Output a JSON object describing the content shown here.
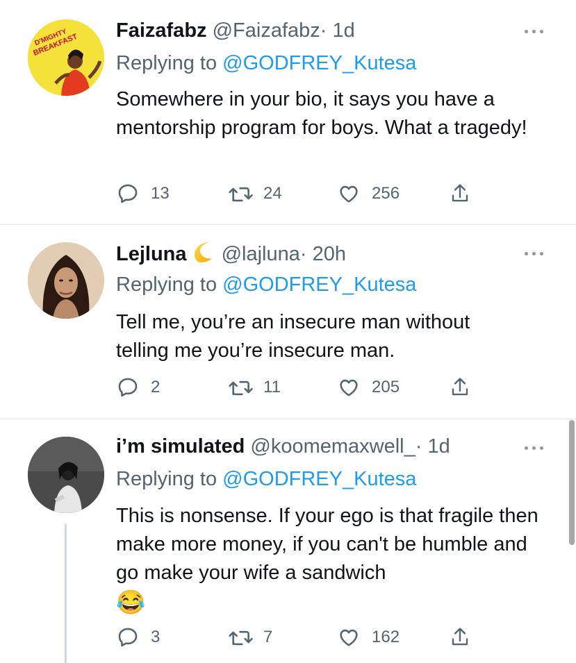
{
  "colors": {
    "link": "#1d9bf0",
    "muted": "#536471",
    "text": "#0f1419"
  },
  "tweets": [
    {
      "display_name": "Faizafabz",
      "handle": "@Faizafabz",
      "time": "· 1d",
      "replying_prefix": "Replying to",
      "replying_to": "@GODFREY_Kutesa",
      "text": "Somewhere in your bio, it says you have a mentorship program for boys. What a tragedy!",
      "replies": "13",
      "retweets": "24",
      "likes": "256",
      "avatar_text": {
        "line1": "D'MIGHTY",
        "line2": "BREAKFAST"
      }
    },
    {
      "display_name": "Lejluna",
      "name_emoji": "crescent-moon-icon",
      "handle": "@lajluna",
      "time": "· 20h",
      "replying_prefix": "Replying to",
      "replying_to": "@GODFREY_Kutesa",
      "text": "Tell me, you’re an insecure man without telling me you’re insecure man.",
      "replies": "2",
      "retweets": "11",
      "likes": "205"
    },
    {
      "display_name": "i’m simulated",
      "handle": "@koomemaxwell_",
      "time": "· 1d",
      "replying_prefix": "Replying to",
      "replying_to": "@GODFREY_Kutesa",
      "text": "This is nonsense. If your ego is that fragile then make more money, if you can't be humble and go make your wife a sandwich",
      "text_emoji": "😂",
      "replies": "3",
      "retweets": "7",
      "likes": "162"
    }
  ]
}
